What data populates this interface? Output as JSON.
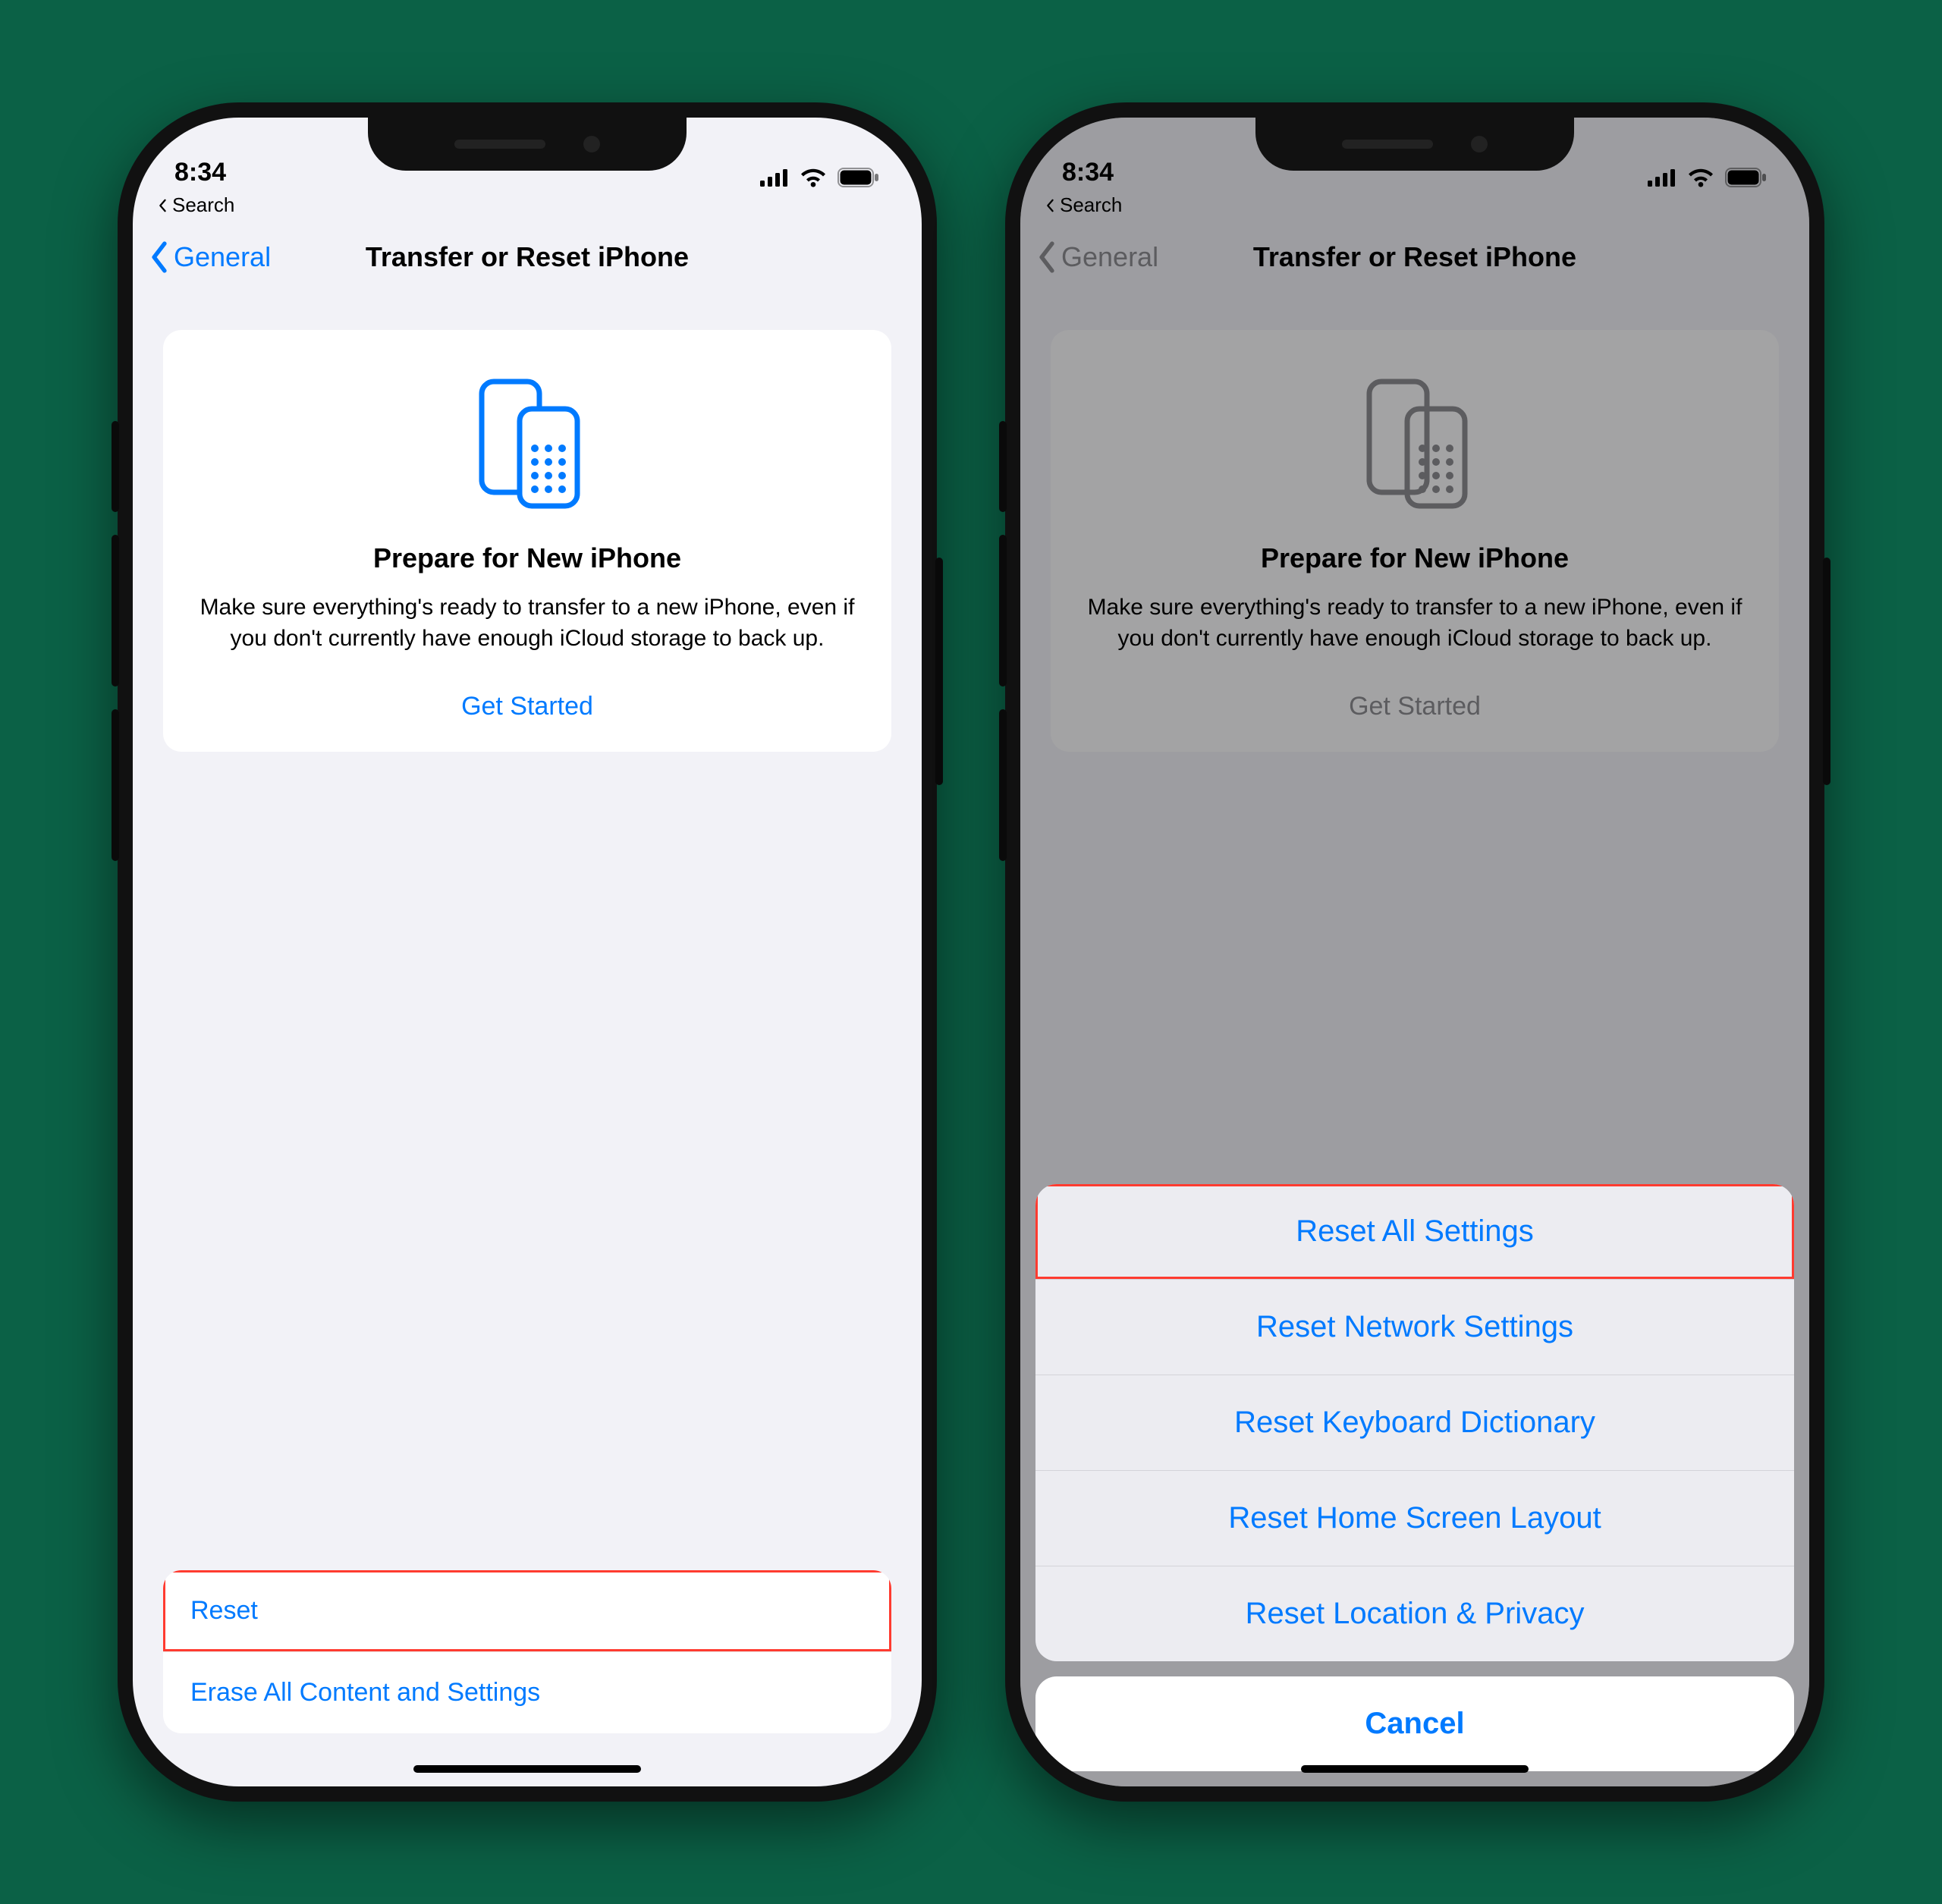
{
  "status": {
    "time": "8:34"
  },
  "breadcrumb": {
    "label": "Search"
  },
  "nav": {
    "back": "General",
    "title": "Transfer or Reset iPhone"
  },
  "prepare_card": {
    "heading": "Prepare for New iPhone",
    "body": "Make sure everything's ready to transfer to a new iPhone, even if you don't currently have enough iCloud storage to back up.",
    "cta": "Get Started"
  },
  "bottom": {
    "reset": "Reset",
    "erase": "Erase All Content and Settings"
  },
  "sheet": {
    "items": [
      "Reset All Settings",
      "Reset Network Settings",
      "Reset Keyboard Dictionary",
      "Reset Home Screen Layout",
      "Reset Location & Privacy"
    ],
    "cancel": "Cancel"
  },
  "colors": {
    "tint": "#007aff",
    "highlight": "#ff3b30"
  }
}
